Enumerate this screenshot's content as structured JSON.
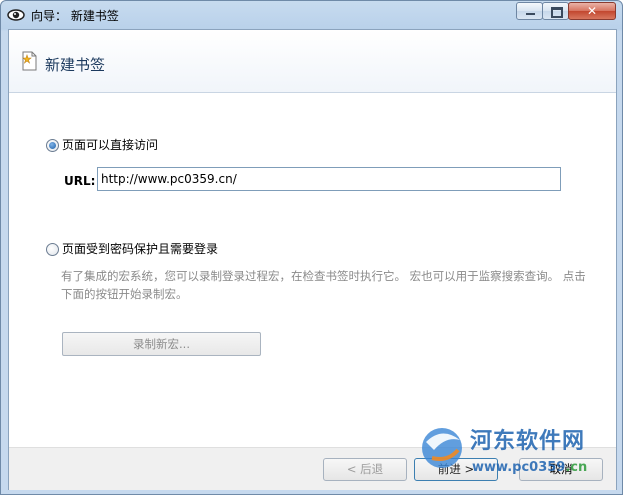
{
  "window": {
    "title": "向导： 新建书签",
    "close_label": "✕"
  },
  "header": {
    "title": "新建书签"
  },
  "options": {
    "direct": {
      "label": "页面可以直接访问",
      "selected": true
    },
    "protected": {
      "label": "页面受到密码保护且需要登录",
      "selected": false
    }
  },
  "url": {
    "label": "URL:",
    "value": "http://www.pc0359.cn/"
  },
  "description": "有了集成的宏系统，您可以录制登录过程宏，在检查书签时执行它。 宏也可以用于监察搜索查询。 点击下面的按钮开始录制宏。",
  "record_button": "录制新宏...",
  "footer": {
    "back": "< 后退",
    "next": "前进 >",
    "cancel": "取消"
  },
  "watermark": {
    "line1": "河东软件网",
    "line2_prefix": "www.pc0359",
    "line2_suffix": ".cn"
  },
  "colors": {
    "accent": "#1e5fa8",
    "watermark": "#1e63b0"
  }
}
